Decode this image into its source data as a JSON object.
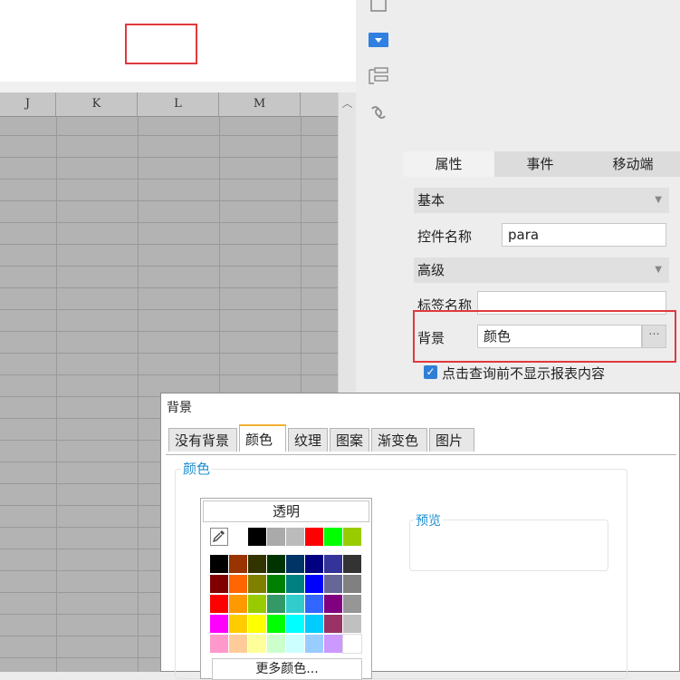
{
  "grid": {
    "columns": [
      "J",
      "K",
      "L",
      "M"
    ]
  },
  "panel": {
    "tabs": [
      "属性",
      "事件",
      "移动端"
    ],
    "section_basic": "基本",
    "control_name_label": "控件名称",
    "control_name_value": "para",
    "section_advanced": "高级",
    "tag_name_label": "标签名称",
    "tag_name_value": "",
    "background_label": "背景",
    "background_value": "颜色",
    "more_button": "···",
    "hide_content_label": "点击查询前不显示报表内容",
    "hide_content_checked": true
  },
  "dialog": {
    "title": "背景",
    "tabs": [
      "没有背景",
      "颜色",
      "纹理",
      "图案",
      "渐变色",
      "图片"
    ],
    "active_tab": "颜色",
    "color_group_title": "颜色",
    "preview_title": "预览",
    "transparent_button": "透明",
    "more_colors_button": "更多颜色...",
    "recent_colors": [
      "#000000",
      "#aaaaaa",
      "#bbbbbb",
      "#ff0000",
      "#00ff00",
      "#99cc00"
    ],
    "palette_rows": [
      [
        "#000000",
        "#993300",
        "#333300",
        "#003300",
        "#003366",
        "#000080",
        "#333399",
        "#333333"
      ],
      [
        "#800000",
        "#ff6600",
        "#808000",
        "#008000",
        "#008080",
        "#0000ff",
        "#666699",
        "#808080"
      ],
      [
        "#ff0000",
        "#ff9900",
        "#99cc00",
        "#339966",
        "#33cccc",
        "#3366ff",
        "#800080",
        "#969696"
      ],
      [
        "#ff00ff",
        "#ffcc00",
        "#ffff00",
        "#00ff00",
        "#00ffff",
        "#00ccff",
        "#993366",
        "#c0c0c0"
      ],
      [
        "#ff99cc",
        "#ffcc99",
        "#ffff99",
        "#ccffcc",
        "#ccffff",
        "#99ccff",
        "#cc99ff",
        "#ffffff"
      ]
    ]
  },
  "colors": {
    "highlight": "#e0393e",
    "accent_blue": "#1c8fd0",
    "active_tab_border": "#f2b030"
  }
}
